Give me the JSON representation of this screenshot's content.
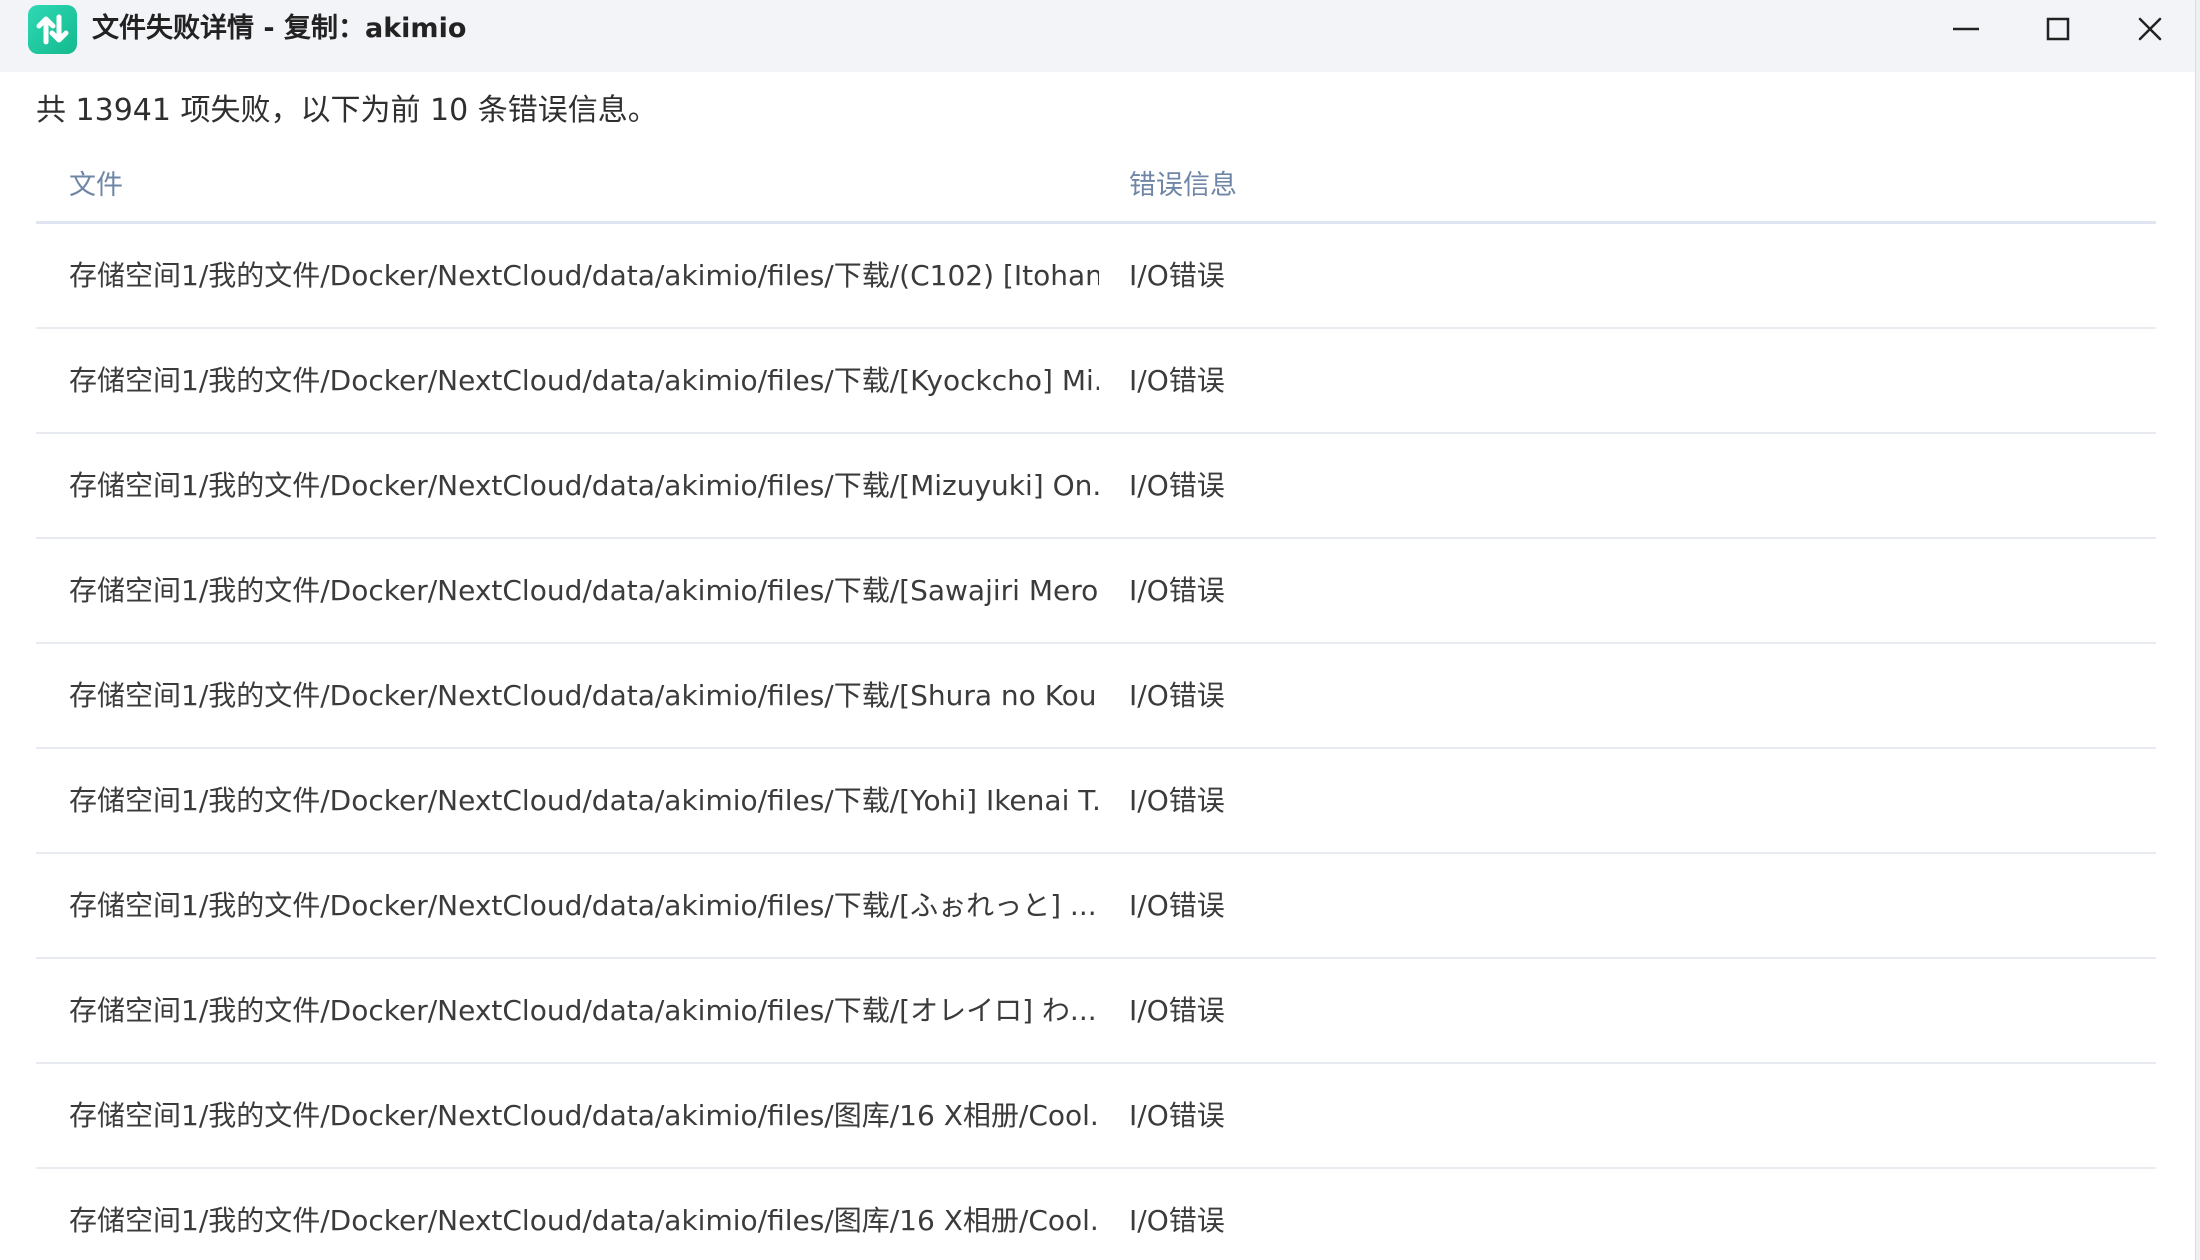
{
  "window": {
    "title": "文件失败详情 - 复制：akimio",
    "icon": "transfer-arrows-icon",
    "controls": {
      "minimize": "minimize-icon",
      "maximize": "maximize-icon",
      "close": "close-icon"
    }
  },
  "summary": "共 13941 项失败，以下为前 10 条错误信息。",
  "table": {
    "columns": [
      "文件",
      "错误信息"
    ],
    "rows": [
      {
        "file": "存储空间1/我的文件/Docker/NextCloud/data/akimio/files/下载/(C102) [Itohan...",
        "error": "I/O错误"
      },
      {
        "file": "存储空间1/我的文件/Docker/NextCloud/data/akimio/files/下载/[Kyockcho] Mi...",
        "error": "I/O错误"
      },
      {
        "file": "存储空间1/我的文件/Docker/NextCloud/data/akimio/files/下载/[Mizuyuki] On...",
        "error": "I/O错误"
      },
      {
        "file": "存储空间1/我的文件/Docker/NextCloud/data/akimio/files/下载/[Sawajiri Mero...",
        "error": "I/O错误"
      },
      {
        "file": "存储空间1/我的文件/Docker/NextCloud/data/akimio/files/下载/[Shura no Kou...",
        "error": "I/O错误"
      },
      {
        "file": "存储空间1/我的文件/Docker/NextCloud/data/akimio/files/下载/[Yohi] Ikenai T...",
        "error": "I/O错误"
      },
      {
        "file": "存储空间1/我的文件/Docker/NextCloud/data/akimio/files/下载/[ふぉれっと] ...",
        "error": "I/O错误"
      },
      {
        "file": "存储空间1/我的文件/Docker/NextCloud/data/akimio/files/下载/[オレイロ] わ...",
        "error": "I/O错误"
      },
      {
        "file": "存储空间1/我的文件/Docker/NextCloud/data/akimio/files/图库/16 X相册/Cool...",
        "error": "I/O错误"
      },
      {
        "file": "存储空间1/我的文件/Docker/NextCloud/data/akimio/files/图库/16 X相册/Cool...",
        "error": "I/O错误"
      }
    ]
  },
  "colors": {
    "titlebar_bg": "#f3f4f7",
    "app_icon": "#1fc9a0",
    "header_text": "#6f86a6",
    "header_divider": "#dfe6f1"
  }
}
